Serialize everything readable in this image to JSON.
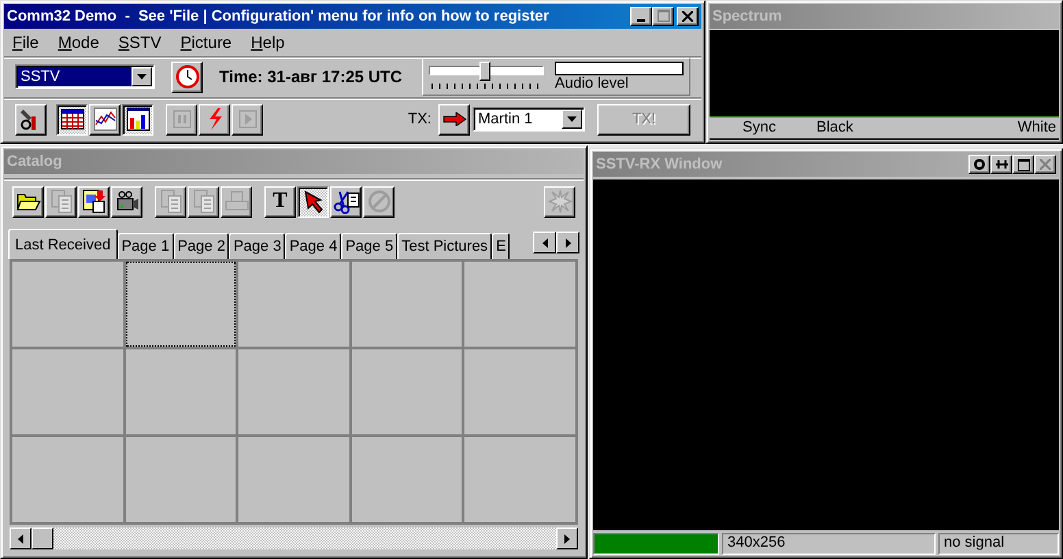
{
  "main_window": {
    "title": "Comm32 Demo  -  See 'File | Configuration' menu for info on how to register",
    "active": true
  },
  "menu": [
    "File",
    "Mode",
    "SSTV",
    "Picture",
    "Help"
  ],
  "mode_select": {
    "value": "SSTV"
  },
  "time": "Time: 31-авг 17:25 UTC",
  "slider": {
    "level": 0.5
  },
  "audio_meter": {
    "label": "Audio level",
    "level": 0
  },
  "toolbar": [
    {
      "kind": "tools",
      "pressed": false,
      "disabled": false
    },
    {
      "kind": "calendar",
      "pressed": true,
      "disabled": false
    },
    {
      "kind": "graph",
      "pressed": false,
      "disabled": false
    },
    {
      "kind": "bars",
      "pressed": true,
      "disabled": false
    },
    {
      "kind": "pause",
      "pressed": false,
      "disabled": true
    },
    {
      "kind": "lightning",
      "pressed": false,
      "disabled": false
    },
    {
      "kind": "play",
      "pressed": false,
      "disabled": true
    }
  ],
  "tx": {
    "label": "TX:",
    "mode": "Martin 1",
    "button": "TX!",
    "button_disabled": true
  },
  "spectrum": {
    "title": "Spectrum",
    "active": false,
    "labels": [
      "Sync",
      "Black",
      "White"
    ]
  },
  "catalog": {
    "title": "Catalog",
    "active": false,
    "toolbar": [
      {
        "kind": "folder",
        "pressed": false,
        "disabled": false
      },
      {
        "kind": "doc",
        "pressed": false,
        "disabled": true
      },
      {
        "kind": "save",
        "pressed": false,
        "disabled": false
      },
      {
        "kind": "camera",
        "pressed": false,
        "disabled": false
      },
      {
        "kind": "paste",
        "pressed": false,
        "disabled": true
      },
      {
        "kind": "paste",
        "pressed": false,
        "disabled": true
      },
      {
        "kind": "printer",
        "pressed": false,
        "disabled": true
      },
      {
        "kind": "text",
        "label": "T",
        "pressed": false,
        "disabled": false
      },
      {
        "kind": "pointer",
        "pressed": true,
        "disabled": false
      },
      {
        "kind": "scissors",
        "pressed": false,
        "disabled": false
      },
      {
        "kind": "no",
        "pressed": false,
        "disabled": true
      },
      {
        "kind": "burst",
        "pressed": false,
        "disabled": true
      }
    ],
    "tabs": [
      {
        "label": "Last Received",
        "selected": true
      },
      {
        "label": "Page 1",
        "selected": false
      },
      {
        "label": "Page 2",
        "selected": false
      },
      {
        "label": "Page 3",
        "selected": false
      },
      {
        "label": "Page 4",
        "selected": false
      },
      {
        "label": "Page 5",
        "selected": false
      },
      {
        "label": "Test Pictures",
        "selected": false
      },
      {
        "label": "E",
        "selected": false
      }
    ],
    "thumbnails": [
      {
        "selected": false
      },
      {
        "selected": true
      },
      {
        "selected": false
      },
      {
        "selected": false
      },
      {
        "selected": false
      },
      {
        "selected": false
      },
      {
        "selected": false
      },
      {
        "selected": false
      },
      {
        "selected": false
      },
      {
        "selected": false
      },
      {
        "selected": false
      },
      {
        "selected": false
      },
      {
        "selected": false
      },
      {
        "selected": false
      },
      {
        "selected": false
      }
    ]
  },
  "rx_window": {
    "title": "SSTV-RX Window",
    "active": false,
    "progress": {
      "level": 1
    },
    "size": "340x256",
    "status": "no signal"
  }
}
